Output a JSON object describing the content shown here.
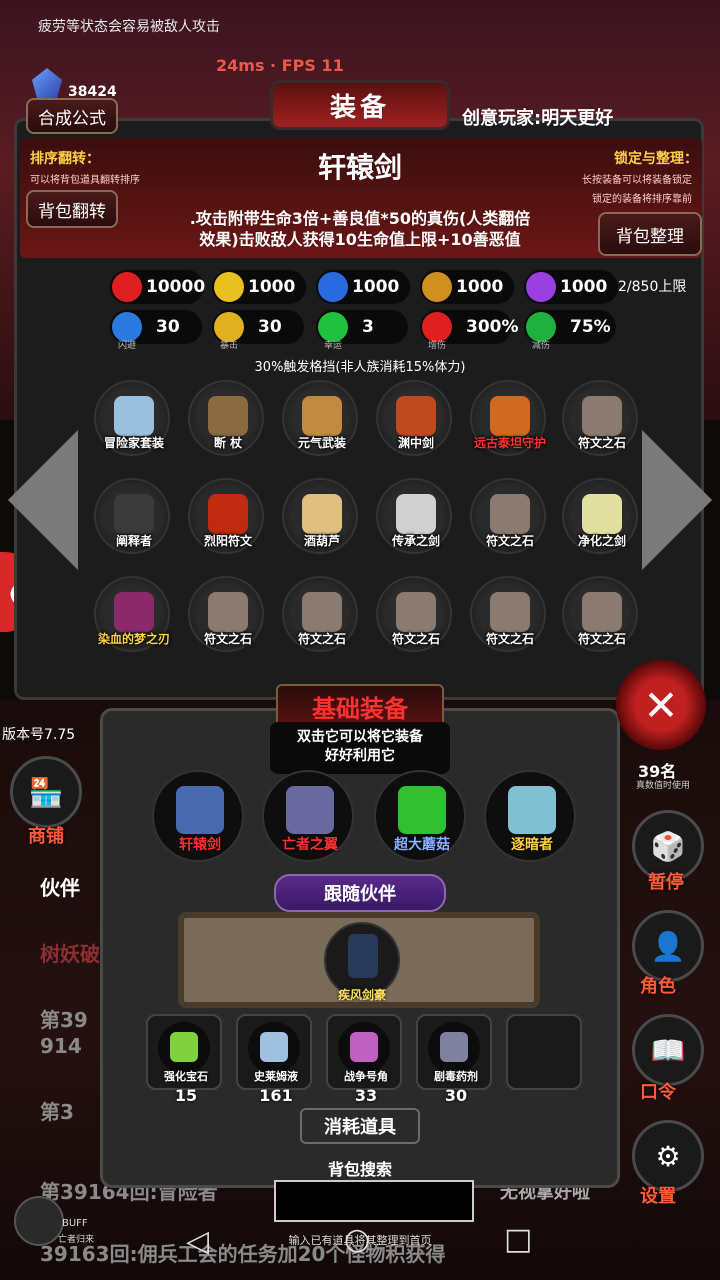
{
  "status": {
    "hint": "疲劳等状态会容易被敌人攻击",
    "fps": "24ms · FPS 11",
    "gem_count": "38424"
  },
  "header": {
    "title": "装备",
    "formula_button": "合成公式",
    "creator": "创意玩家:明天更好",
    "flip_button": "背包翻转",
    "organize_button": "背包整理",
    "sort_title": "排序翻转：",
    "sort_desc": "可以将背包道具翻转排序",
    "lock_title": "锁定与整理：",
    "lock_desc1": "长按装备可以将装备锁定",
    "lock_desc2": "锁定的装备将排序靠前",
    "capacity": "2/850上限"
  },
  "item": {
    "name": "轩辕剑",
    "desc_line1": ".攻击附带生命3倍+善良值*50的真伤(人类翻倍",
    "desc_line2": "效果)击败敌人获得10生命值上限+10善恶值",
    "trigger": "30%触发格挡(非人族消耗15%体力)"
  },
  "stats_main": [
    {
      "icon": "heart-icon",
      "value": "10000",
      "color": "#e02020"
    },
    {
      "icon": "strength-icon",
      "value": "1000",
      "color": "#e8c020"
    },
    {
      "icon": "helmet-icon",
      "value": "1000",
      "color": "#2a6ae0"
    },
    {
      "icon": "sword-icon",
      "value": "1000",
      "color": "#d09020"
    },
    {
      "icon": "lightning-icon",
      "value": "1000",
      "color": "#9a40e0"
    }
  ],
  "stats_sub": [
    {
      "icon": "dodge-icon",
      "value": "30",
      "label": "闪避",
      "color": "#2a7ae0"
    },
    {
      "icon": "crit-icon",
      "value": "30",
      "label": "暴击",
      "color": "#e0b020"
    },
    {
      "icon": "clover-icon",
      "value": "3",
      "label": "幸运",
      "color": "#20c040"
    },
    {
      "icon": "damage-up-icon",
      "value": "300%",
      "label": "增伤",
      "color": "#e02020"
    },
    {
      "icon": "shield-icon",
      "value": "75%",
      "label": "减伤",
      "color": "#20b040"
    }
  ],
  "inventory": [
    {
      "label": "冒险家套装",
      "color": "#9ac0e0",
      "label_color": "#ffffff"
    },
    {
      "label": "断 杖",
      "color": "#8a6a40",
      "label_color": "#ffffff"
    },
    {
      "label": "元气武装",
      "color": "#c08a40",
      "label_color": "#ffffff"
    },
    {
      "label": "渊中剑",
      "color": "#c04a20",
      "label_color": "#ffffff"
    },
    {
      "label": "远古泰坦守护",
      "color": "#d06a20",
      "label_color": "#ff3030"
    },
    {
      "label": "符文之石",
      "color": "#8a7a70",
      "label_color": "#ffffff"
    },
    {
      "label": "阐释者",
      "color": "#3a3a3a",
      "label_color": "#ffffff"
    },
    {
      "label": "烈阳符文",
      "color": "#c02a10",
      "label_color": "#ffffff"
    },
    {
      "label": "酒葫芦",
      "color": "#e0c080",
      "label_color": "#ffffff"
    },
    {
      "label": "传承之剑",
      "color": "#d0d0d0",
      "label_color": "#ffffff"
    },
    {
      "label": "符文之石",
      "color": "#8a7a70",
      "label_color": "#ffffff"
    },
    {
      "label": "净化之剑",
      "color": "#e0e0a0",
      "label_color": "#ffffff"
    },
    {
      "label": "染血的梦之刃",
      "color": "#8a2a6a",
      "label_color": "#ffd040"
    },
    {
      "label": "符文之石",
      "color": "#8a7a70",
      "label_color": "#ffffff"
    },
    {
      "label": "符文之石",
      "color": "#8a7a70",
      "label_color": "#ffffff"
    },
    {
      "label": "符文之石",
      "color": "#8a7a70",
      "label_color": "#ffffff"
    },
    {
      "label": "符文之石",
      "color": "#8a7a70",
      "label_color": "#ffffff"
    },
    {
      "label": "符文之石",
      "color": "#8a7a70",
      "label_color": "#ffffff"
    }
  ],
  "basic_equipment": {
    "title": "基础装备",
    "hint_line1": "双击它可以将它装备",
    "hint_line2": "好好利用它",
    "slots": [
      {
        "label": "轩辕剑",
        "color": "#4a6ab0",
        "label_color": "#ff3030"
      },
      {
        "label": "亡者之翼",
        "color": "#6a6aa0",
        "label_color": "#ff3030"
      },
      {
        "label": "超大蘑菇",
        "color": "#30c030",
        "label_color": "#8ab0ff"
      },
      {
        "label": "逐暗者",
        "color": "#80c0d0",
        "label_color": "#ffd040"
      }
    ]
  },
  "companion": {
    "tab": "跟随伙伴",
    "name": "疾风剑豪"
  },
  "consumables": {
    "tab": "消耗道具",
    "items": [
      {
        "label": "强化宝石",
        "count": "15",
        "color": "#80d040"
      },
      {
        "label": "史莱姆液",
        "count": "161",
        "color": "#a0c0e0"
      },
      {
        "label": "战争号角",
        "count": "33",
        "color": "#c060c0"
      },
      {
        "label": "剧毒药剂",
        "count": "30",
        "color": "#8080a0"
      },
      {
        "label": "",
        "count": "",
        "color": "#1a1a1a"
      }
    ]
  },
  "search": {
    "title": "背包搜索",
    "hint": "输入已有道具将其整理到首页"
  },
  "background": {
    "version": "版本号7.75",
    "shop": "商铺",
    "companion_word": "伙伴",
    "tree_text": "树妖破",
    "round1": "第39",
    "round1b": "914",
    "round2": "第3",
    "round3": "第39164回:冒险者",
    "round4": "39163回:佣兵工会的任务加20个怪物积获得",
    "stat_right": "39名",
    "stat_right_sub": "真数值时使用",
    "pause": "暂停",
    "role": "角色",
    "command": "口令",
    "settings": "设置",
    "watch": "无视拿好啦",
    "buff": "BUFF",
    "buff_sub": "亡者归来"
  },
  "colors": {
    "accent_red": "#e02020",
    "gold": "#ffcf4a",
    "panel": "#1c1c1c"
  }
}
